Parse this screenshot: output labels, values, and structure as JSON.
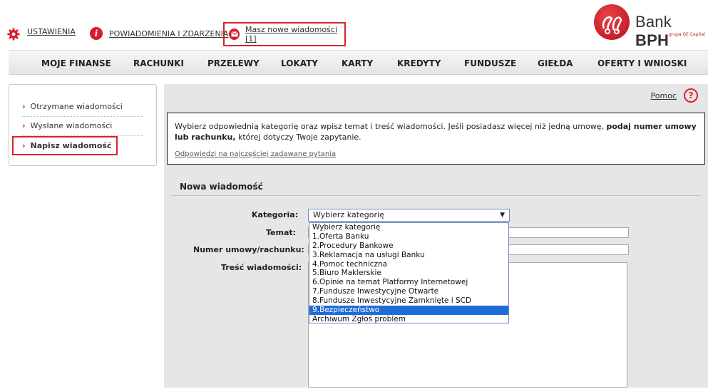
{
  "topbar": {
    "settings": "USTAWIENIA",
    "notifications": "POWIADOMIENIA I ZDARZENIA",
    "messages": "Masz nowe wiadomości [1]"
  },
  "logo": {
    "name_regular": "Bank ",
    "name_bold": "BPH",
    "sub": "grupa GE Capital"
  },
  "nav": [
    "MOJE FINANSE",
    "RACHUNKI",
    "PRZELEWY",
    "LOKATY",
    "KARTY",
    "KREDYTY",
    "FUNDUSZE",
    "GIEŁDA",
    "OFERTY I WNIOSKI"
  ],
  "sidebar": {
    "items": [
      {
        "label": "Otrzymane wiadomości"
      },
      {
        "label": "Wysłane wiadomości"
      },
      {
        "label": "Napisz wiadomość"
      }
    ]
  },
  "help": {
    "label": "Pomoc",
    "icon": "?"
  },
  "info": {
    "text_part1": "Wybierz odpowiednią kategorię oraz wpisz temat i treść wiadomości. Jeśli posiadasz więcej niż jedną umowę, ",
    "text_bold": "podaj numer umowy lub rachunku,",
    "text_part2": " której dotyczy Twoje zapytanie.",
    "faq_link": "Odpowiedzi na najczęściej zadawane pytania"
  },
  "form": {
    "title": "Nowa wiadomość",
    "category_label": "Kategoria:",
    "subject_label": "Temat:",
    "number_label": "Numer umowy/rachunku:",
    "body_label": "Treść wiadomości:",
    "category_value": "Wybierz kategorię",
    "category_options": [
      "Wybierz kategorię",
      "1.Oferta Banku",
      "2.Procedury Bankowe",
      "3.Reklamacja na usługi Banku",
      "4.Pomoc techniczna",
      "5.Biuro Maklerskie",
      "6.Opinie na temat Platformy Internetowej",
      "7.Fundusze Inwestycyjne Otwarte",
      "8.Fundusze Inwestycyjne Zamknięte i SCD",
      "9.Bezpieczeństwo",
      "Archiwum Zgłoś problem"
    ],
    "highlighted_option_index": 9
  }
}
